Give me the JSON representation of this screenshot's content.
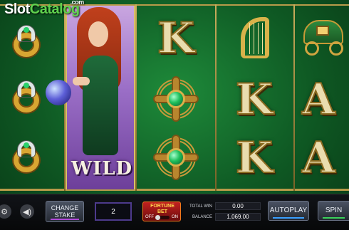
{
  "logo": {
    "part1": "Slot",
    "part2": "Catalog",
    "suffix": ".com"
  },
  "reels": {
    "wild_label": "WILD",
    "letters": {
      "k": "K",
      "a": "A"
    },
    "symbols": {
      "col1": [
        "horseshoe-ring",
        "horseshoe-ring",
        "horseshoe-ring"
      ],
      "col2": [
        "wild"
      ],
      "col3": [
        "K",
        "celtic-cross",
        "celtic-cross"
      ],
      "col4": [
        "harp",
        "K",
        "K"
      ],
      "col5": [
        "gypsy-wagon",
        "A",
        "A"
      ]
    }
  },
  "controls": {
    "settings_icon": "gear-icon",
    "sound_icon": "speaker-icon",
    "change_stake_line1": "CHANGE",
    "change_stake_line2": "STAKE",
    "stake_value": "2",
    "fortune_line1": "FORTUNE",
    "fortune_line2": "BET",
    "fortune_off": "OFF",
    "fortune_on": "ON",
    "total_win_label": "TOTAL WIN",
    "total_win_value": "0.00",
    "balance_label": "BALANCE",
    "balance_value": "1,069.00",
    "autoplay_label": "AUTOPLAY",
    "spin_label": "SPIN"
  },
  "colors": {
    "felt": "#1e8a3a",
    "gold": "#c9ad5c",
    "stake_underline": "#b04ad8",
    "autoplay_underline": "#3aa0ff",
    "spin_underline": "#3ad15a"
  }
}
